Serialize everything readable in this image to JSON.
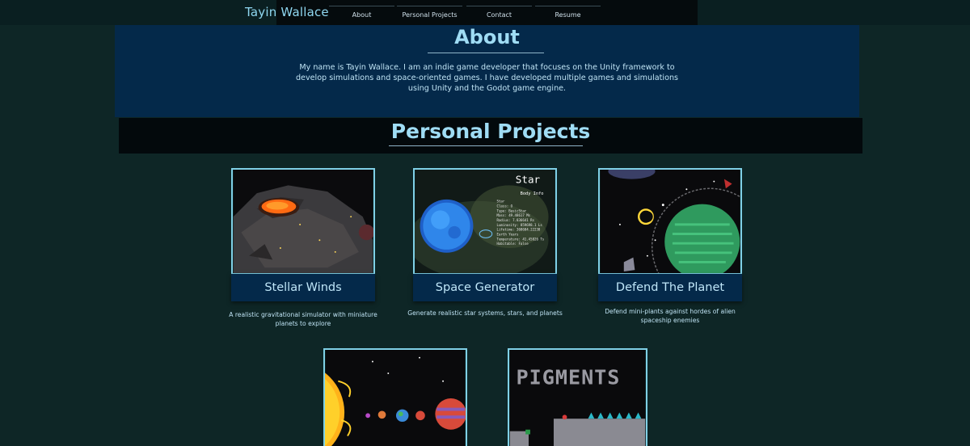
{
  "header": {
    "brand": "Tayin Wallace",
    "nav": [
      "About",
      "Personal Projects",
      "Contact",
      "Resume"
    ]
  },
  "about": {
    "title": "About",
    "text": "My name is Tayin Wallace. I am an indie game developer that focuses on the Unity framework to develop simulations and space-oriented games. I have developed multiple games and simulations using Unity and the Godot game engine."
  },
  "projects": {
    "title": "Personal Projects",
    "items": [
      {
        "title": "Stellar Winds",
        "description": "A realistic gravitational simulator with miniature planets to explore"
      },
      {
        "title": "Space Generator",
        "description": "Generate realistic star systems, stars, and planets"
      },
      {
        "title": "Defend The Planet",
        "description": "Defend mini-plants against hordes of alien spaceship enemies"
      }
    ],
    "space_generator_overlay": {
      "heading": "Star",
      "subheading": "Body Info",
      "lines": [
        "Star",
        "Class: O",
        "Type: BasicStar",
        "Mass: 49.48617 Ms",
        "Radius: 7.836641 Rs",
        "Luminosity: 859698.1 Ls",
        "Lifetime: 368604.22238",
        "Earth Years",
        "Temperature: 41.45826 Ts",
        "Habitable: False"
      ]
    },
    "pigments_logo": "PIGMENTS"
  },
  "colors": {
    "page_bg": "#0e2626",
    "about_bg": "#04294a",
    "accent": "#9fdcf4",
    "card_border": "#7fd0e6"
  }
}
